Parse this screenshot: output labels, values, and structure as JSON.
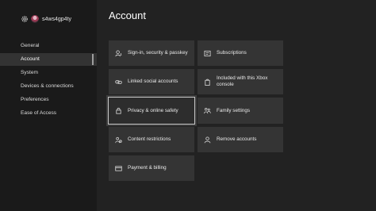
{
  "profile": {
    "gamertag": "s4ws4gp4ty"
  },
  "sidebar": {
    "items": [
      {
        "label": "General"
      },
      {
        "label": "Account"
      },
      {
        "label": "System"
      },
      {
        "label": "Devices & connections"
      },
      {
        "label": "Preferences"
      },
      {
        "label": "Ease of Access"
      }
    ],
    "selected_index": 1
  },
  "main": {
    "title": "Account",
    "tiles": [
      {
        "label": "Sign-in, security & passkey",
        "icon": "sign-in-icon"
      },
      {
        "label": "Subscriptions",
        "icon": "subscriptions-icon"
      },
      {
        "label": "Linked social accounts",
        "icon": "linked-accounts-icon"
      },
      {
        "label": "Included with this Xbox console",
        "icon": "console-included-icon"
      },
      {
        "label": "Privacy & online safety",
        "icon": "lock-icon",
        "focused": true
      },
      {
        "label": "Family settings",
        "icon": "family-icon"
      },
      {
        "label": "Content restrictions",
        "icon": "content-restrictions-icon"
      },
      {
        "label": "Remove accounts",
        "icon": "remove-account-icon"
      },
      {
        "label": "Payment & billing",
        "icon": "payment-card-icon"
      }
    ]
  }
}
